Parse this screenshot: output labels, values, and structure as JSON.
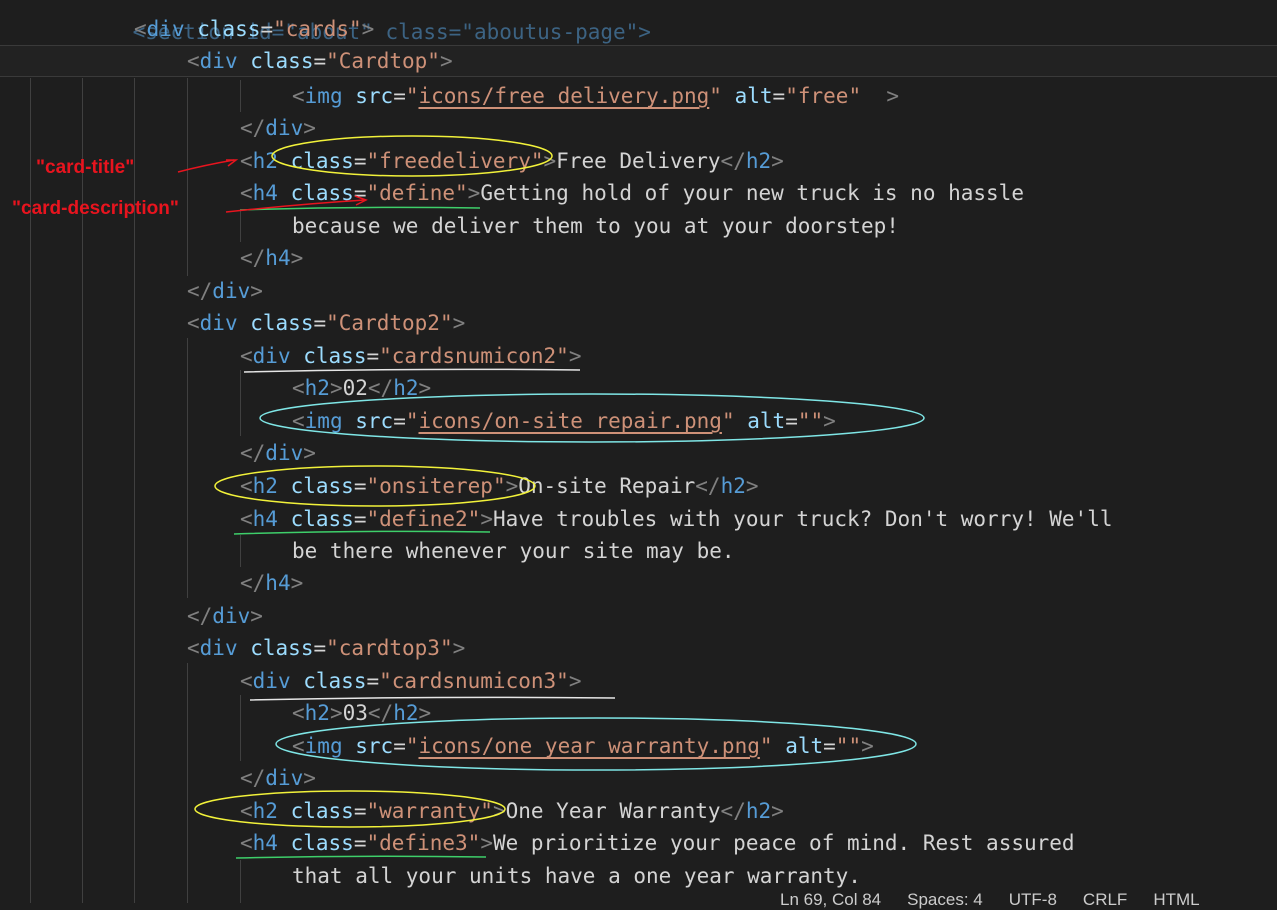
{
  "editor": {
    "lines": [
      {
        "text": "<section id=\"about\" class=\"aboutus-page\">"
      },
      {
        "open": "div",
        "attr": "class",
        "val": "cards"
      },
      {
        "open": "div",
        "attr": "class",
        "val": "Cardtop"
      },
      {
        "img_src": "icons/free delivery.png",
        "img_alt": "free"
      },
      {
        "close": "div"
      },
      {
        "h": "h2",
        "attr": "class",
        "val": "freedelivery",
        "content": "Free Delivery"
      },
      {
        "h": "h4",
        "attr": "class",
        "val": "define",
        "content": "Getting hold of your new truck is no hassle"
      },
      {
        "content": "because we deliver them to you at your doorstep!"
      },
      {
        "close": "h4"
      },
      {
        "close": "div"
      },
      {
        "open": "div",
        "attr": "class",
        "val": "Cardtop2"
      },
      {
        "open": "div",
        "attr": "class",
        "val": "cardsnumicon2"
      },
      {
        "h": "h2",
        "content": "02"
      },
      {
        "img_src": "icons/on-site repair.png",
        "img_alt": ""
      },
      {
        "close": "div"
      },
      {
        "h": "h2",
        "attr": "class",
        "val": "onsiterep",
        "content": "On-site Repair"
      },
      {
        "h": "h4",
        "attr": "class",
        "val": "define2",
        "content": "Have troubles with your truck? Don't worry! We'll"
      },
      {
        "content": "be there whenever your site may be."
      },
      {
        "close": "h4"
      },
      {
        "close": "div"
      },
      {
        "open": "div",
        "attr": "class",
        "val": "cardtop3"
      },
      {
        "open": "div",
        "attr": "class",
        "val": "cardsnumicon3"
      },
      {
        "h": "h2",
        "content": "03"
      },
      {
        "img_src": "icons/one year warranty.png",
        "img_alt": ""
      },
      {
        "close": "div"
      },
      {
        "h": "h2",
        "attr": "class",
        "val": "warranty",
        "content": "One Year Warranty"
      },
      {
        "h": "h4",
        "attr": "class",
        "val": "define3",
        "content": "We prioritize your peace of mind. Rest assured"
      },
      {
        "content": "that all your units have a one year warranty."
      }
    ]
  },
  "annotations": {
    "card_title": "\"card-title\"",
    "card_description": "\"card-description\""
  },
  "statusbar": {
    "position": "Ln 69, Col 84",
    "spaces": "Spaces: 4",
    "encoding": "UTF-8",
    "eol": "CRLF",
    "language": "HTML"
  },
  "colors": {
    "background": "#1e1e1e",
    "tag": "#569cd6",
    "attribute": "#9cdcfe",
    "string": "#ce9178",
    "annotation_red": "#e8141e",
    "annotation_yellow": "#f2f23a",
    "annotation_cyan": "#7fe6e6",
    "annotation_green": "#3ecf6a"
  }
}
